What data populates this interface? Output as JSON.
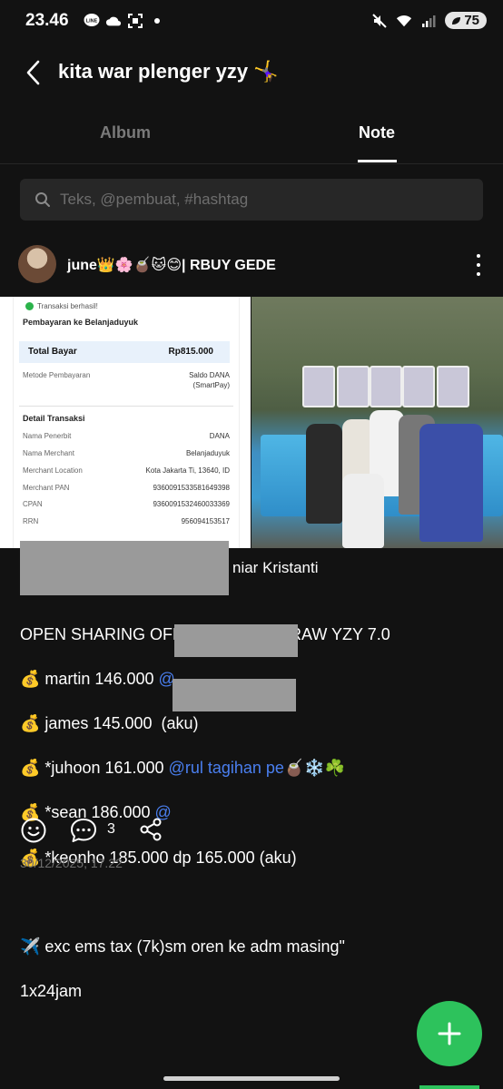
{
  "status_bar": {
    "time": "23.46",
    "battery": "75",
    "icons": [
      "line-app-icon",
      "cloud-icon",
      "screenshot-icon",
      "dot-icon",
      "mute-icon",
      "wifi-icon",
      "signal-icon",
      "battery-icon"
    ]
  },
  "header": {
    "back_icon": "chevron-left-icon",
    "title": "kita war plenger yzy 🤸‍♀️"
  },
  "tabs": [
    {
      "label": "Album",
      "active": false
    },
    {
      "label": "Note",
      "active": true
    }
  ],
  "search": {
    "placeholder": "Teks, @pembuat, #hashtag",
    "value": ""
  },
  "post": {
    "author": "june👑🌸🧉🐱😊| RBUY GEDE",
    "receipt": {
      "status": "Transaksi berhasil!",
      "pay_title": "Pembayaran ke Belanjaduyuk",
      "total_label": "Total Bayar",
      "total_value": "Rp815.000",
      "method_label": "Metode Pembayaran",
      "method_value_1": "Saldo DANA",
      "method_value_2": "(SmartPay)",
      "detail_title": "Detail Transaksi",
      "rows": [
        {
          "label": "Nama Penerbit",
          "value": "DANA"
        },
        {
          "label": "Nama Merchant",
          "value": "Belanjaduyuk"
        },
        {
          "label": "Merchant Location",
          "value": "Kota Jakarta Ti, 13640, ID"
        },
        {
          "label": "Merchant PAN",
          "value": "9360091533581649398"
        },
        {
          "label": "CPAN",
          "value": "9360091532460033369"
        },
        {
          "label": "RRN",
          "value": "956094153517"
        }
      ]
    },
    "name_line": "niar Kristanti",
    "text_lines": [
      {
        "text": "OPEN SHARING OFFLINE LUCKYDRAW YZY 7.0",
        "mention": ""
      },
      {
        "text": "💰 martin 146.000 ",
        "mention": "@"
      },
      {
        "text": "💰 james 145.000  (aku)",
        "mention": ""
      },
      {
        "text": "💰 *juhoon 161.000 ",
        "mention": "@rul tagihan pe",
        "suffix": "🧉❄️☘️"
      },
      {
        "text": "💰 *sean 186.000 ",
        "mention": "@"
      },
      {
        "text": "💰 *keonho 185.000 dp 165.000 (aku)",
        "mention": ""
      },
      {
        "text": "",
        "mention": ""
      },
      {
        "text": "✈️ exc ems tax (7k)sm oren ke adm masing\"",
        "mention": ""
      },
      {
        "text": "1x24jam",
        "mention": ""
      }
    ],
    "comment_count": "3",
    "timestamp": "30/12/2025, 17.22"
  },
  "fab": {
    "icon": "plus-icon"
  }
}
